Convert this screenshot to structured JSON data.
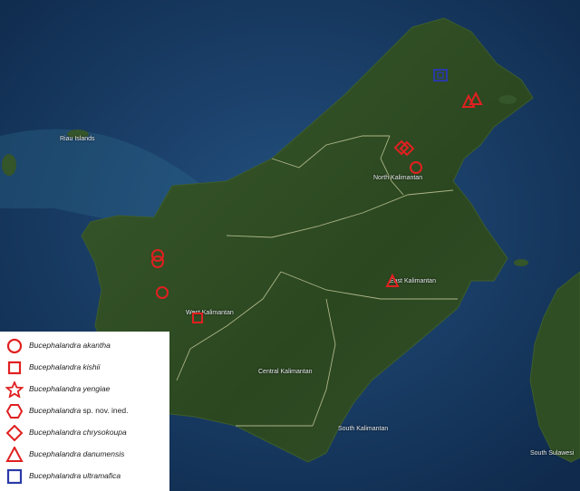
{
  "map": {
    "region_labels": {
      "north_kalimantan": "North Kalimantan",
      "east_kalimantan": "East Kalimantan",
      "west_kalimantan": "West Kalimantan",
      "central_kalimantan": "Central Kalimantan",
      "south_kalimantan": "South Kalimantan",
      "south_sulawesi": "South Sulawesi",
      "riau_islands": "Riau Islands"
    },
    "colors": {
      "sea": "#1b3e6b",
      "land": "#2d4a22",
      "marker": "#e02020",
      "marker_ultramafica": "#2a3aa8",
      "border": "#d8d8a8"
    }
  },
  "legend": {
    "items": [
      {
        "species": "Bucephalandra akantha",
        "suffix": "",
        "symbol": "circle",
        "color": "#e02020"
      },
      {
        "species": "Bucephalandra kishii",
        "suffix": "",
        "symbol": "square",
        "color": "#e02020"
      },
      {
        "species": "Bucephalandra yengiae",
        "suffix": "",
        "symbol": "star",
        "color": "#e02020"
      },
      {
        "species": "Bucephalandra",
        "suffix": " sp. nov. ined.",
        "symbol": "hexagon",
        "color": "#e02020"
      },
      {
        "species": "Bucephalandra chrysokoupa",
        "suffix": "",
        "symbol": "diamond",
        "color": "#e02020"
      },
      {
        "species": "Bucephalandra danumensis",
        "suffix": "",
        "symbol": "triangle",
        "color": "#e02020"
      },
      {
        "species": "Bucephalandra ultramafica",
        "suffix": "",
        "symbol": "square",
        "color": "#2a3aa8"
      }
    ]
  }
}
